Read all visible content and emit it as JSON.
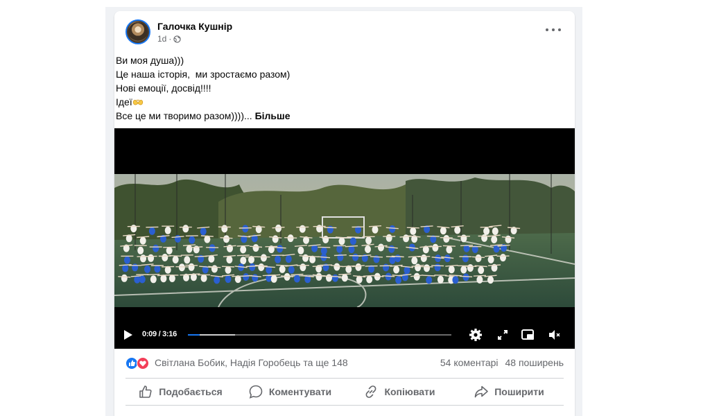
{
  "post": {
    "author": "Галочка Кушнір",
    "time": "1d",
    "separator": "·",
    "audience_icon": "globe-icon",
    "text_lines": [
      "Ви моя душа)))",
      "Це наша історія,  ми зростаємо разом)",
      "Нові емоції, досвід!!!!",
      "Ідеї",
      "Все це ми творимо разом))))..."
    ],
    "emoji_icon": "heart-hands-emoji",
    "see_more": "Більше"
  },
  "video": {
    "current_time": "0:09",
    "duration": "3:16",
    "time_separator": " / ",
    "played_fraction": 0.046,
    "buffered_fraction": 0.18,
    "icons": [
      "play-icon",
      "settings-gear-icon",
      "fullscreen-icon",
      "picture-in-picture-icon",
      "muted-speaker-icon"
    ]
  },
  "reactions": {
    "names": "Світлана Бобик, Надія Горобець та ще 148",
    "comments": "54 коментарі",
    "shares": "48 поширень",
    "icons": [
      "like-reaction-icon",
      "love-reaction-icon"
    ]
  },
  "actions": {
    "like": "Подобається",
    "comment": "Коментувати",
    "copy": "Копіювати",
    "share": "Поширити"
  },
  "colors": {
    "accent": "#1877f2",
    "love": "#f33e58",
    "secondary_text": "#65676b"
  }
}
